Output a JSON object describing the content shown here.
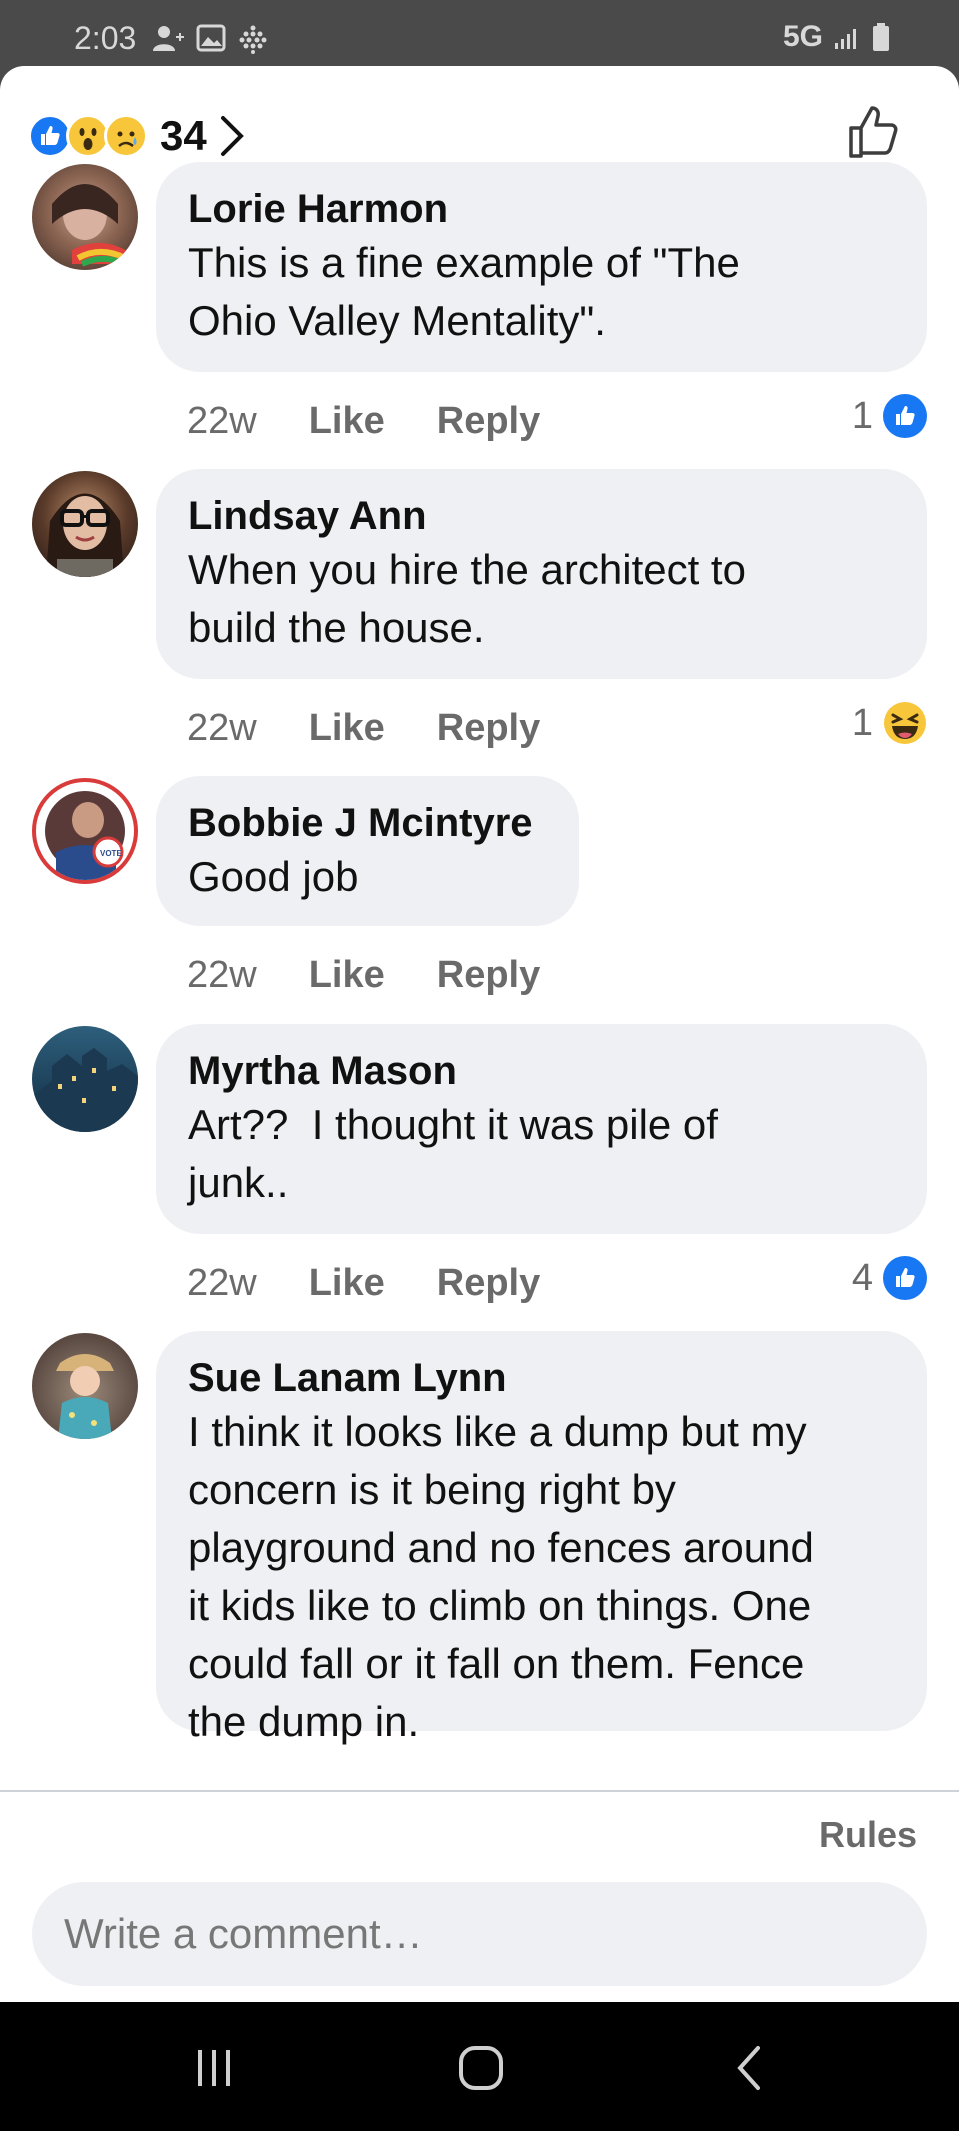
{
  "status_bar": {
    "time": "2:03",
    "network": "5G",
    "left_icons": [
      "person-add-icon",
      "image-icon",
      "grid-dots-icon"
    ],
    "right_icons": [
      "signal-icon",
      "battery-icon"
    ]
  },
  "reactions_summary": {
    "icons": [
      "like-reaction-icon",
      "wow-reaction-icon",
      "sad-reaction-icon"
    ],
    "count": "34"
  },
  "comments": [
    {
      "author": "Lorie Harmon",
      "text": "This is a fine example of \"The\nOhio Valley Mentality\".",
      "time": "22w",
      "like_label": "Like",
      "reply_label": "Reply",
      "reaction_count": "1",
      "reaction_icon": "like-reaction-icon"
    },
    {
      "author": "Lindsay Ann",
      "text": "When you hire the architect to\nbuild the house.",
      "time": "22w",
      "like_label": "Like",
      "reply_label": "Reply",
      "reaction_count": "1",
      "reaction_icon": "haha-reaction-icon"
    },
    {
      "author": "Bobbie J Mcintyre",
      "text": "Good job",
      "time": "22w",
      "like_label": "Like",
      "reply_label": "Reply",
      "reaction_count": "",
      "reaction_icon": ""
    },
    {
      "author": "Myrtha Mason",
      "text": "Art??  I thought it was pile of\njunk..",
      "time": "22w",
      "like_label": "Like",
      "reply_label": "Reply",
      "reaction_count": "4",
      "reaction_icon": "like-reaction-icon"
    },
    {
      "author": "Sue Lanam Lynn",
      "text": "I think it looks like a dump but my\nconcern is it being right by\nplayground and no fences around\nit kids like to climb on things. One\ncould fall or it fall on them. Fence\nthe dump in.",
      "time": "",
      "like_label": "",
      "reply_label": "",
      "reaction_count": "",
      "reaction_icon": ""
    }
  ],
  "footer": {
    "rules_label": "Rules",
    "comment_placeholder": "Write a comment…"
  },
  "colors": {
    "facebook_blue": "#1877f2",
    "bubble_bg": "#eff0f3",
    "meta_gray": "#6a6a6a"
  }
}
